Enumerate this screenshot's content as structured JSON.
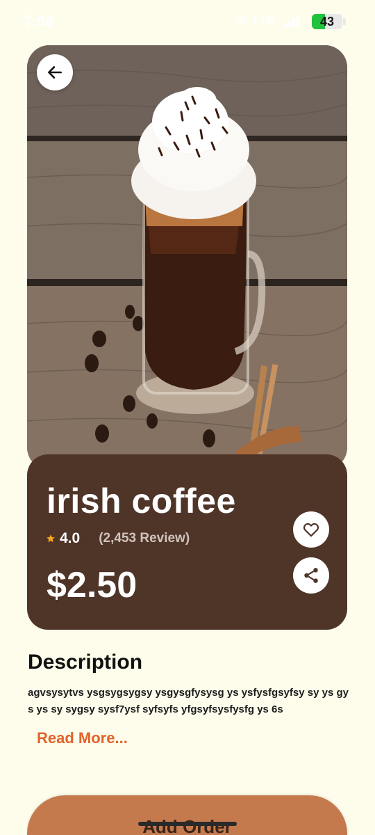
{
  "status_bar": {
    "time": "7:58",
    "network": "LTE",
    "battery": "43",
    "battery_level": 0.43,
    "battery_color": "#22c23e"
  },
  "product": {
    "name": "irish coffee",
    "rating": "4.0",
    "reviews": "(2,453 Review)",
    "price": "$2.50",
    "image_icon": "irish-coffee-photo"
  },
  "description": {
    "title": "Description",
    "text": "agvsysytvs ysgsygsygsy ysgysgfysysg ys ysfysfgsyfsy sy ys gys ys sy sygsy sysf7ysf syfsyfs yfgsyfsysfysfg ys 6s",
    "read_more": "Read More..."
  },
  "actions": {
    "add_order": "Add Order"
  },
  "colors": {
    "background": "#fefdec",
    "card": "#4f3428",
    "accent": "#e0642a",
    "button": "#c57a4e",
    "star": "#f5a623"
  },
  "icons": {
    "back": "arrow-left-icon",
    "favorite": "heart-icon",
    "share": "share-icon",
    "rating": "star-icon"
  }
}
